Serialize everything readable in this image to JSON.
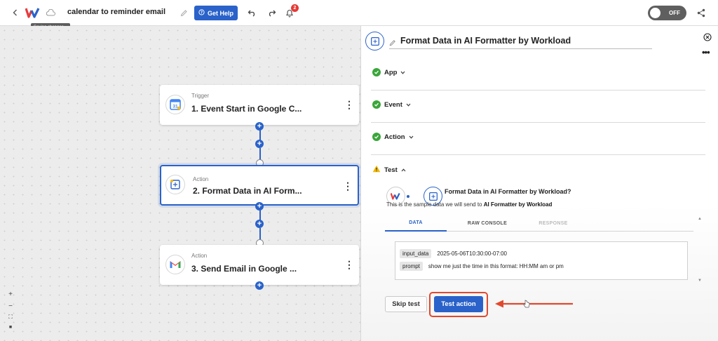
{
  "header": {
    "title": "calendar to reminder email",
    "help_label": "Get Help",
    "notifications_count": "2",
    "saving_tooltip": "Saving changes...",
    "toggle_label": "OFF",
    "toggle_on": false
  },
  "canvas": {
    "nodes": [
      {
        "type_label": "Trigger",
        "title": "1. Event Start in Google C...",
        "icon": "google-calendar-icon"
      },
      {
        "type_label": "Action",
        "title": "2. Format Data in AI Form...",
        "icon": "ai-formatter-icon"
      },
      {
        "type_label": "Action",
        "title": "3. Send Email in Google ...",
        "icon": "gmail-icon"
      }
    ],
    "zoom_controls": [
      "+",
      "−",
      "⛶",
      "🔒"
    ]
  },
  "panel": {
    "title": "Format Data in AI Formatter by Workload",
    "sections": [
      {
        "label": "App",
        "status": "complete"
      },
      {
        "label": "Event",
        "status": "complete"
      },
      {
        "label": "Action",
        "status": "complete"
      },
      {
        "label": "Test",
        "status": "warning"
      }
    ],
    "test": {
      "question": "Format Data in AI Formatter by Workload?",
      "note_prefix": "This is the sample data we will send to",
      "note_target": "AI Formatter by Workload",
      "tabs": [
        "DATA",
        "RAW CONSOLE",
        "RESPONSE"
      ],
      "active_tab": "DATA",
      "data": [
        {
          "key": "input_data",
          "value": "2025-05-06T10:30:00-07:00"
        },
        {
          "key": "prompt",
          "value": "show me just the time in this format: HH:MM am or pm"
        }
      ],
      "skip_label": "Skip test",
      "test_label": "Test action"
    }
  },
  "colors": {
    "accent": "#2a62c9",
    "success": "#3aa63a",
    "warning": "#f2b705",
    "highlight": "#e0492f"
  }
}
